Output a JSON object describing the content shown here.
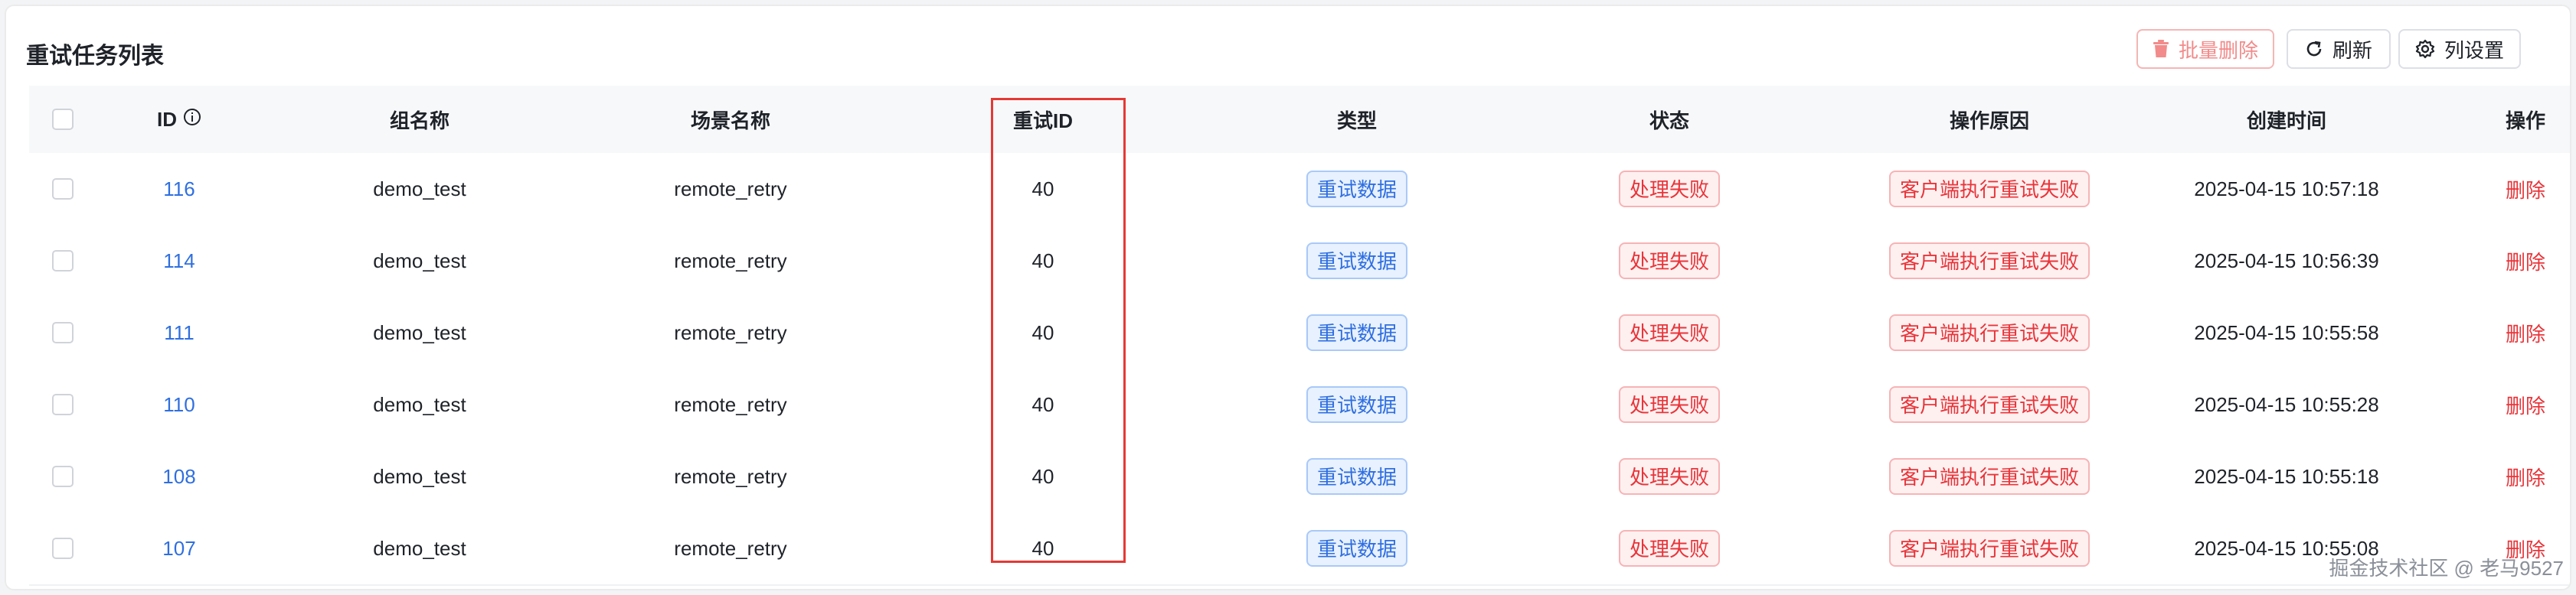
{
  "page": {
    "title": "重试任务列表"
  },
  "toolbar": {
    "batch_delete": "批量删除",
    "refresh": "刷新",
    "column_settings": "列设置"
  },
  "table": {
    "columns": [
      "ID",
      "组名称",
      "场景名称",
      "重试ID",
      "类型",
      "状态",
      "操作原因",
      "创建时间",
      "操作"
    ],
    "rows": [
      {
        "id": "116",
        "group": "demo_test",
        "scene": "remote_retry",
        "retry_id": "40",
        "type": "重试数据",
        "status": "处理失败",
        "reason": "客户端执行重试失败",
        "created": "2025-04-15 10:57:18",
        "action": "删除"
      },
      {
        "id": "114",
        "group": "demo_test",
        "scene": "remote_retry",
        "retry_id": "40",
        "type": "重试数据",
        "status": "处理失败",
        "reason": "客户端执行重试失败",
        "created": "2025-04-15 10:56:39",
        "action": "删除"
      },
      {
        "id": "111",
        "group": "demo_test",
        "scene": "remote_retry",
        "retry_id": "40",
        "type": "重试数据",
        "status": "处理失败",
        "reason": "客户端执行重试失败",
        "created": "2025-04-15 10:55:58",
        "action": "删除"
      },
      {
        "id": "110",
        "group": "demo_test",
        "scene": "remote_retry",
        "retry_id": "40",
        "type": "重试数据",
        "status": "处理失败",
        "reason": "客户端执行重试失败",
        "created": "2025-04-15 10:55:28",
        "action": "删除"
      },
      {
        "id": "108",
        "group": "demo_test",
        "scene": "remote_retry",
        "retry_id": "40",
        "type": "重试数据",
        "status": "处理失败",
        "reason": "客户端执行重试失败",
        "created": "2025-04-15 10:55:18",
        "action": "删除"
      },
      {
        "id": "107",
        "group": "demo_test",
        "scene": "remote_retry",
        "retry_id": "40",
        "type": "重试数据",
        "status": "处理失败",
        "reason": "客户端执行重试失败",
        "created": "2025-04-15 10:55:08",
        "action": "删除"
      }
    ]
  },
  "watermark": "掘金技术社区 @ 老马9527",
  "colors": {
    "link": "#2f6fe0",
    "danger": "#e8353a",
    "highlight": "#e53935"
  },
  "icons": {
    "batch_delete": "trash-icon",
    "refresh": "refresh-icon",
    "column_settings": "gear-icon",
    "id_info": "info-icon"
  }
}
